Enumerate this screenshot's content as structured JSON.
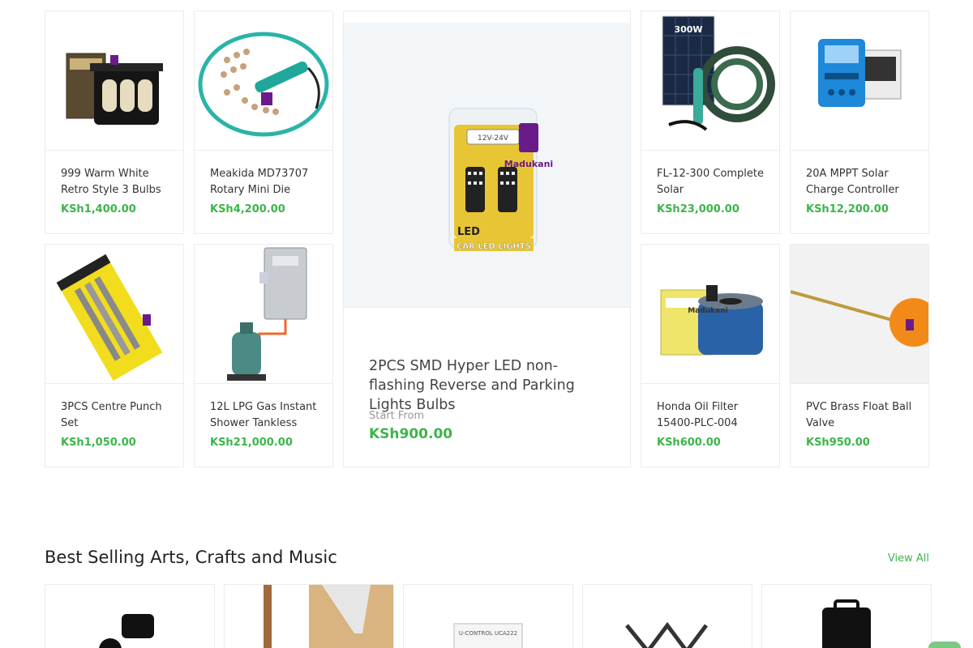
{
  "products": [
    {
      "name": "999 Warm White Retro Style 3 Bulbs",
      "price": "KSh1,400.00"
    },
    {
      "name": "Meakida MD73707 Rotary Mini Die",
      "price": "KSh4,200.00"
    },
    {
      "name": "FL-12-300 Complete Solar",
      "price": "KSh23,000.00"
    },
    {
      "name": "20A MPPT Solar Charge Controller",
      "price": "KSh12,200.00"
    },
    {
      "name": "3PCS Centre Punch Set",
      "price": "KSh1,050.00"
    },
    {
      "name": "12L LPG Gas Instant Shower Tankless",
      "price": "KSh21,000.00"
    },
    {
      "name": "Honda Oil Filter 15400-PLC-004",
      "price": "KSh600.00"
    },
    {
      "name": "PVC Brass Float Ball Valve",
      "price": "KSh950.00"
    }
  ],
  "featured": {
    "name": "2PCS SMD Hyper LED non-flashing Reverse and Parking Lights Bulbs",
    "start_label": "Start From",
    "price": "KSh900.00",
    "package_voltage": "12V-24V",
    "package_brand": "LED",
    "package_caption": "CAR LED LIGHTS",
    "watermark": "Madukani"
  },
  "product_images": {
    "solar_panel_label": "300W",
    "watermark": "Madukani",
    "crafts_box_label": "U-CONTROL UCA222"
  },
  "section": {
    "title": "Best Selling Arts, Crafts and Music",
    "view_all": "View All"
  },
  "colors": {
    "accent": "#3cb54a",
    "brand_purple": "#6a1b8a"
  }
}
